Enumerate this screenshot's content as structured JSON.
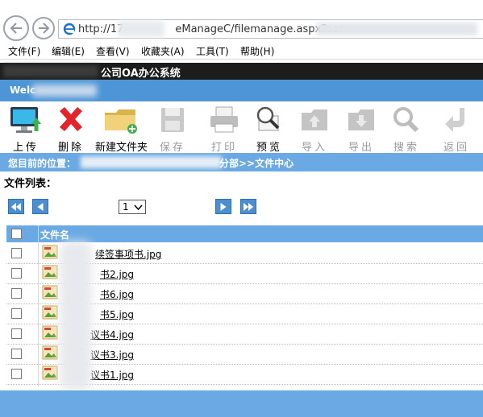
{
  "browser": {
    "url_prefix": "http://17",
    "url_middle": "eManageC/filemanage.aspx?cor",
    "menu": [
      "文件(F)",
      "编辑(E)",
      "查看(V)",
      "收藏夹(A)",
      "工具(T)",
      "帮助(H)"
    ]
  },
  "app": {
    "title": "公司OA办公系统",
    "welcome": "Welc"
  },
  "toolbar": {
    "upload": "上传",
    "delete": "删除",
    "new_folder": "新建文件夹",
    "save": "保存",
    "print": "打印",
    "preview": "预览",
    "import": "导入",
    "export": "导出",
    "search": "搜索",
    "back": "返回"
  },
  "location": {
    "label": "您目前的位置：",
    "path": "分部>>文件中心"
  },
  "list": {
    "title": "文件列表：",
    "page": "1",
    "header": "文件名",
    "files": [
      "续签事项书.jpg",
      "书2.jpg",
      "书6.jpg",
      "书5.jpg",
      "议书4.jpg",
      "议书3.jpg",
      "议书1.jpg"
    ]
  },
  "colors": {
    "accent": "#6aa9e3",
    "welcome_bar": "#4d95d6",
    "title_bar": "#1c1c1c"
  }
}
